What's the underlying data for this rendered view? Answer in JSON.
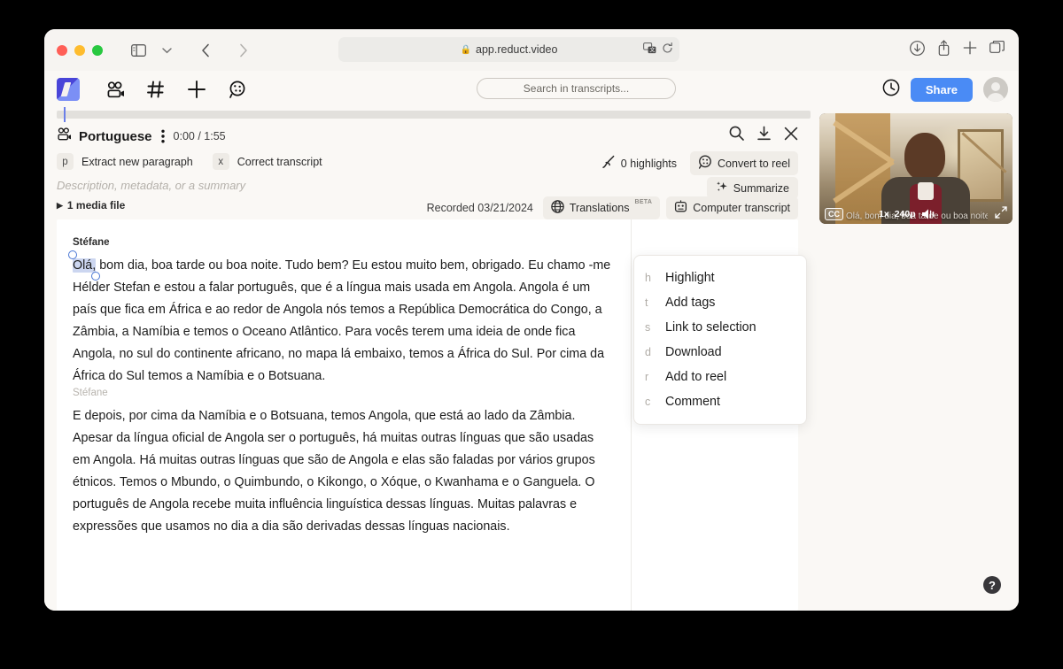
{
  "browser": {
    "url": "app.reduct.video",
    "lock_icon": "lock-icon",
    "icons": {
      "sidebar": "sidebar-toggle-icon",
      "chevron": "chevron-down-icon",
      "back": "back-arrow-icon",
      "forward": "forward-arrow-icon",
      "shield": "privacy-shield-icon",
      "translate": "translate-icon",
      "reload": "reload-icon",
      "download": "download-icon",
      "share": "share-icon",
      "newtab": "plus-icon",
      "tabs": "tab-overview-icon"
    }
  },
  "appbar": {
    "logo": "reduct-logo",
    "nav_icons": [
      "video-people-icon",
      "hash-icon",
      "plus-icon",
      "record-icon"
    ],
    "search_placeholder": "Search in transcripts...",
    "history_icon": "clock-icon",
    "share_label": "Share",
    "avatar": "user-avatar",
    "accent": "#4a8bf5"
  },
  "document": {
    "title": "Portuguese",
    "speaker_icon": "video-people-icon",
    "kebab": "more-options-icon",
    "timecode": "0:00 / 1:55",
    "header_actions": [
      "search-icon",
      "download-icon",
      "close-icon"
    ]
  },
  "toolbar": {
    "shortcuts": [
      {
        "key": "p",
        "label": "Extract new paragraph"
      },
      {
        "key": "x",
        "label": "Correct transcript"
      }
    ],
    "highlights_label": "0 highlights",
    "highlights_icon": "highlighter-icon",
    "convert_label": "Convert to reel",
    "convert_icon": "reel-icon"
  },
  "description": {
    "placeholder": "Description, metadata, or a summary",
    "summarize_label": "Summarize",
    "summarize_icon": "sparkle-icon"
  },
  "meta": {
    "media_file": "1 media file",
    "recorded": "Recorded 03/21/2024",
    "translations_label": "Translations",
    "translations_badge": "BETA",
    "translations_icon": "globe-icon",
    "computer_transcript_label": "Computer transcript",
    "computer_transcript_icon": "robot-icon"
  },
  "transcript": {
    "blocks": [
      {
        "speaker": "Stéfane",
        "speaker_dim": false,
        "selected_text": "Olá,",
        "text": " bom dia, boa tarde ou boa noite. Tudo bem? Eu estou muito bem, obrigado. Eu chamo -me Hélder Stefan e estou a falar português, que é a língua mais usada em Angola. Angola é um país que fica em África e ao redor de Angola nós temos a República Democrática do Congo, a Zâmbia, a Namíbia e temos o Oceano Atlântico. Para vocês terem uma ideia de onde fica Angola, no sul do continente africano, no mapa lá embaixo, temos a África do Sul. Por cima da África do Sul temos a Namíbia e o Botsuana."
      },
      {
        "speaker": "Stéfane",
        "speaker_dim": true,
        "selected_text": "",
        "text": "E depois, por cima da Namíbia e o Botsuana, temos Angola, que está ao lado da Zâmbia. Apesar da língua oficial de Angola ser o português, há muitas outras línguas que são usadas em Angola. Há muitas outras línguas que são de Angola e elas são faladas por vários grupos étnicos. Temos o Mbundo, o Quimbundo, o Kikongo, o Xóque, o Kwanhama e o Ganguela. O português de Angola recebe muita influência linguística dessas línguas. Muitas palavras e expressões que usamos no dia a dia são derivadas dessas línguas nacionais."
      }
    ]
  },
  "context_menu": {
    "items": [
      {
        "key": "h",
        "label": "Highlight"
      },
      {
        "key": "t",
        "label": "Add tags"
      },
      {
        "key": "s",
        "label": "Link to selection"
      },
      {
        "key": "d",
        "label": "Download"
      },
      {
        "key": "r",
        "label": "Add to reel"
      },
      {
        "key": "c",
        "label": "Comment"
      }
    ]
  },
  "video": {
    "subtitle": "Olá, bom dia, boa tarde ou boa noite",
    "cc_label": "CC",
    "speed": "1x",
    "quality": "240p",
    "volume_icon": "volume-icon",
    "expand_icon": "expand-icon"
  },
  "help": {
    "label": "?"
  }
}
